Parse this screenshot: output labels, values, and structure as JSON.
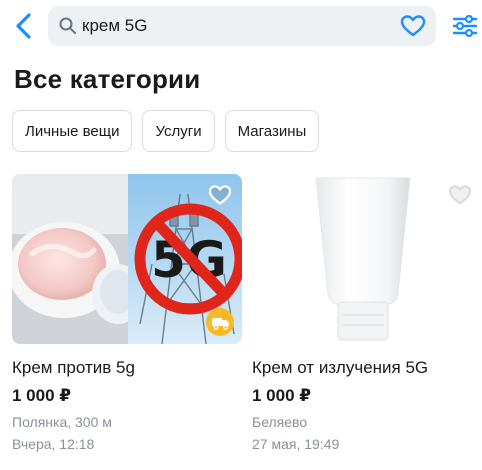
{
  "search": {
    "query": "крем 5G"
  },
  "page": {
    "title": "Все категории"
  },
  "chips": [
    "Личные вещи",
    "Услуги",
    "Магазины"
  ],
  "listings": [
    {
      "title": "Крем против 5g",
      "price": "1 000 ₽",
      "location": "Полянка, 300 м",
      "date": "Вчера, 12:18",
      "image_text": "5G"
    },
    {
      "title": "Крем от излучения 5G",
      "price": "1 000 ₽",
      "location": "Беляево",
      "date": "27 мая, 19:49"
    }
  ],
  "colors": {
    "accent": "#1a8fff",
    "muted": "#8a8f98",
    "no5g_red": "#e0261b",
    "delivery": "#f7b928"
  },
  "icons": [
    "back-arrow-icon",
    "search-icon",
    "heart-icon",
    "filters-icon",
    "delivery-icon"
  ]
}
